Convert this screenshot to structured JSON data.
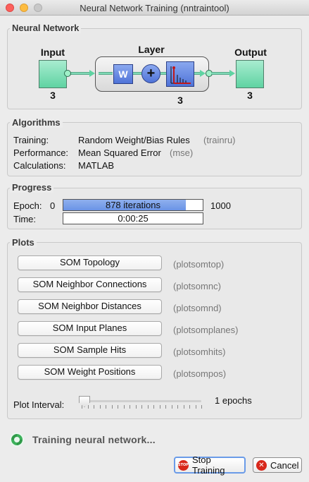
{
  "window": {
    "title": "Neural Network Training (nntraintool)"
  },
  "network": {
    "section_title": "Neural Network",
    "input_label": "Input",
    "input_size": "3",
    "layer_label": "Layer",
    "layer_size": "3",
    "output_label": "Output",
    "output_size": "3",
    "weight_symbol": "W",
    "sum_symbol": "+"
  },
  "algorithms": {
    "section_title": "Algorithms",
    "rows": [
      {
        "label": "Training:",
        "value": "Random Weight/Bias Rules",
        "code": "(trainru)"
      },
      {
        "label": "Performance:",
        "value": "Mean Squared Error",
        "code": "(mse)"
      },
      {
        "label": "Calculations:",
        "value": "MATLAB",
        "code": ""
      }
    ]
  },
  "progress": {
    "section_title": "Progress",
    "epoch_label": "Epoch:",
    "epoch_min": "0",
    "epoch_text": "878 iterations",
    "epoch_max": "1000",
    "epoch_fraction": 0.878,
    "time_label": "Time:",
    "time_value": "0:00:25"
  },
  "plots": {
    "section_title": "Plots",
    "buttons": [
      {
        "label": "SOM Topology",
        "code": "(plotsomtop)"
      },
      {
        "label": "SOM Neighbor Connections",
        "code": "(plotsomnc)"
      },
      {
        "label": "SOM Neighbor Distances",
        "code": "(plotsomnd)"
      },
      {
        "label": "SOM Input Planes",
        "code": "(plotsomplanes)"
      },
      {
        "label": "SOM Sample Hits",
        "code": "(plotsomhits)"
      },
      {
        "label": "SOM Weight Positions",
        "code": "(plotsompos)"
      }
    ],
    "interval_label": "Plot Interval:",
    "interval_value": "1 epochs",
    "interval_fraction": 0.0
  },
  "status": {
    "text": "Training neural network..."
  },
  "actions": {
    "stop_label": "Stop Training",
    "stop_icon_text": "STOP",
    "cancel_label": "Cancel",
    "cancel_icon_text": "✕"
  },
  "colors": {
    "progress_fill": "#6a93e6",
    "network_green": "#5fd3a2",
    "network_blue": "#4f73d8",
    "stop_red": "#d8281b"
  }
}
